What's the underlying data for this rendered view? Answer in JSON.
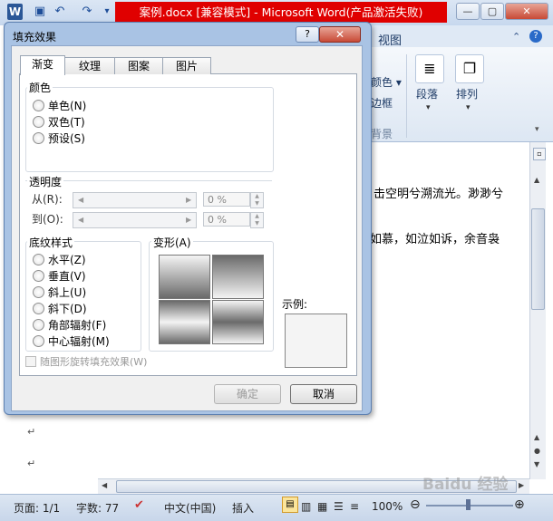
{
  "word": {
    "title": "案例.docx [兼容模式] - Microsoft Word(产品激活失败)",
    "tab_view": "视图",
    "ribbon": {
      "color_label": "颜色 ▾",
      "border_label": "边框",
      "background_label": "背景",
      "paragraph_label": "段落",
      "arrange_label": "排列"
    },
    "doc_lines": [
      "击空明兮溯流光。渺渺兮",
      "如慕，如泣如诉，余音袅"
    ],
    "para_mark": "↵",
    "status": {
      "page": "页面: 1/1",
      "words": "字数: 77",
      "language": "中文(中国)",
      "insert": "插入",
      "zoom": "100%"
    },
    "watermark": "Baidu 经验"
  },
  "dialog": {
    "title": "填充效果",
    "help_glyph": "?",
    "close_glyph": "✕",
    "tabs": [
      "渐变",
      "纹理",
      "图案",
      "图片"
    ],
    "colors": {
      "title": "颜色",
      "options": [
        "单色(N)",
        "双色(T)",
        "预设(S)"
      ]
    },
    "transparency": {
      "title": "透明度",
      "from_label": "从(R):",
      "to_label": "到(O):",
      "from_value": "0 %",
      "to_value": "0 %"
    },
    "shading": {
      "title": "底纹样式",
      "options": [
        "水平(Z)",
        "垂直(V)",
        "斜上(U)",
        "斜下(D)",
        "角部辐射(F)",
        "中心辐射(M)"
      ]
    },
    "variants": {
      "title": "变形(A)"
    },
    "sample_label": "示例:",
    "rotate_checkbox": "随图形旋转填充效果(W)",
    "ok_label": "确定",
    "cancel_label": "取消"
  },
  "colors": {
    "title_bar_red": "#e00000",
    "dialog_frame": "#a9c3e4",
    "close_red": "#c84a36"
  }
}
